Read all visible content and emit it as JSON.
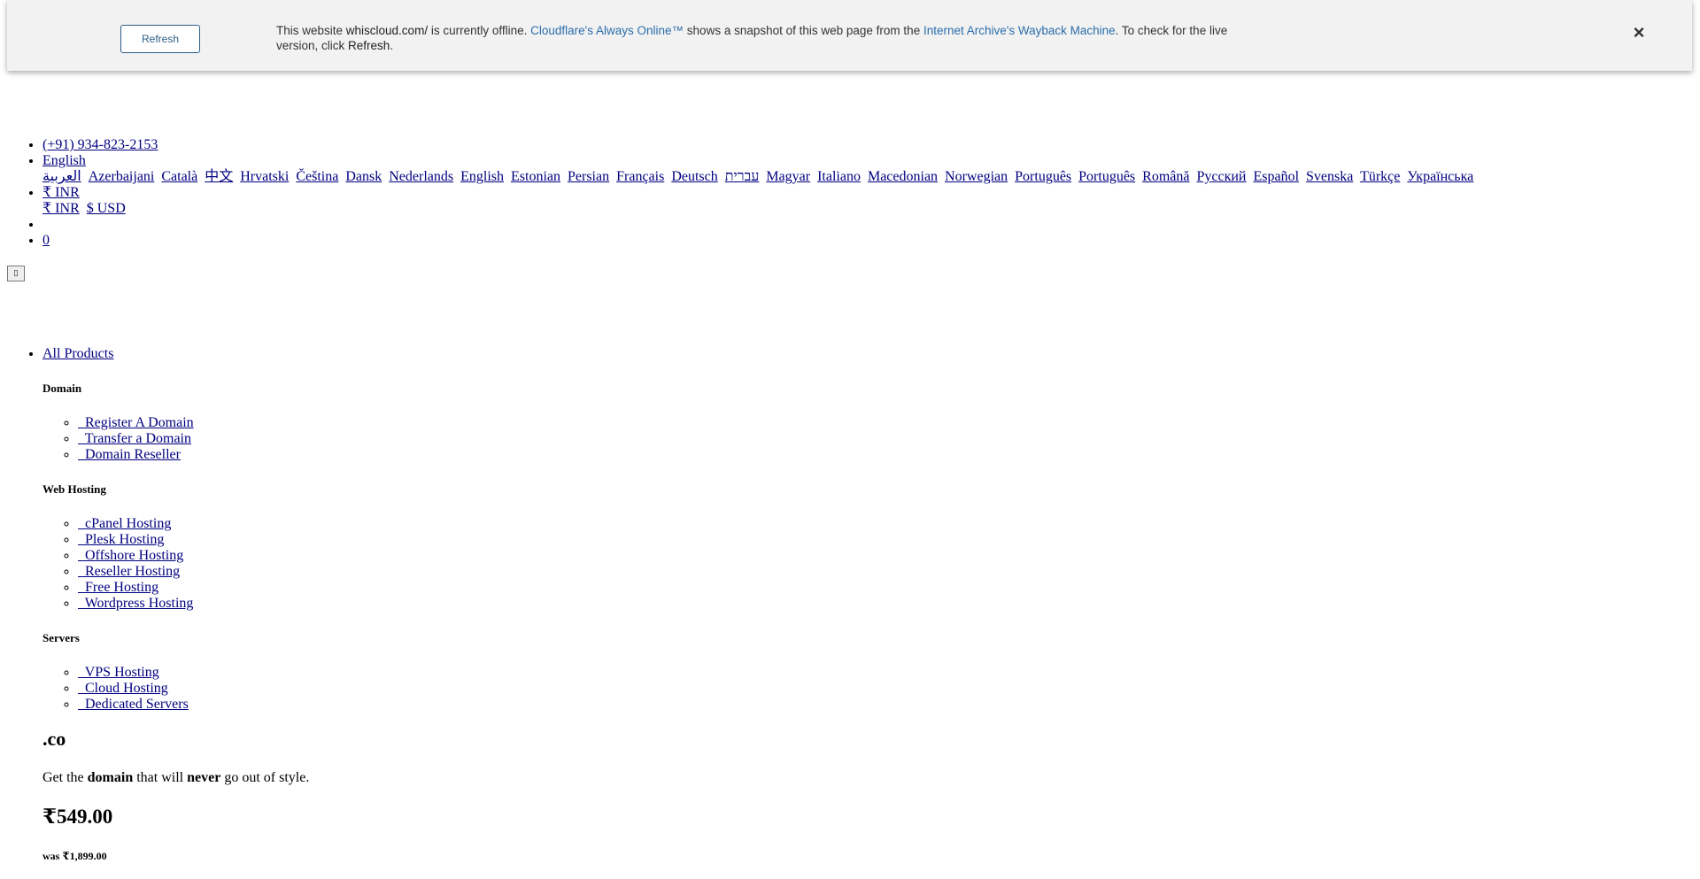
{
  "cf_banner": {
    "refresh_label": "Refresh",
    "msg_prefix": "This website ",
    "site": "whiscloud.com/",
    "msg_mid1": " is currently offline. ",
    "cf_link": "Cloudflare's Always Online™",
    "msg_mid2": " shows a snapshot of this web page from the ",
    "wayback_link": "Internet Archive's Wayback Machine",
    "msg_mid3": ". To check for the live version, click ",
    "refresh_word": "Refresh",
    "msg_end": ".",
    "close_glyph": "×"
  },
  "topbar": {
    "phone": "(+91) 934-823-2153",
    "language_current": " English",
    "languages": [
      " العربية",
      " Azerbaijani",
      " Català",
      " 中文",
      " Hrvatski",
      " Čeština",
      " Dansk",
      " Nederlands",
      " English",
      " Estonian",
      " Persian",
      " Français",
      " Deutsch",
      " עברית",
      " Magyar",
      " Italiano",
      " Macedonian",
      " Norwegian",
      " Português",
      " Português",
      " Română",
      " Русский",
      " Español",
      " Svenska",
      " Türkçe",
      " Українська"
    ],
    "currency_current": "₹ INR",
    "currencies": [
      "₹ INR",
      "$ USD"
    ],
    "cart_count": "0",
    "toggle_glyph": "▯"
  },
  "menu": {
    "all_products": "All Products",
    "groups": [
      {
        "title": "Domain",
        "items": [
          "  Register A Domain",
          "  Transfer a Domain",
          "  Domain Reseller"
        ]
      },
      {
        "title": "Web Hosting",
        "items": [
          "  cPanel Hosting",
          "  Plesk Hosting",
          "  Offshore Hosting",
          "  Reseller Hosting",
          "  Free Hosting",
          "  Wordpress Hosting"
        ]
      },
      {
        "title": "Servers",
        "items": [
          "  VPS Hosting",
          "  Cloud Hosting",
          "  Dedicated Servers"
        ]
      }
    ]
  },
  "promo": {
    "tld": ".co",
    "tag_pre": "Get the ",
    "tag_b1": "domain",
    "tag_mid": " that will ",
    "tag_b2": "never",
    "tag_end": " go out of style.",
    "price": "₹549.00",
    "was": "was ₹1,899.00"
  }
}
